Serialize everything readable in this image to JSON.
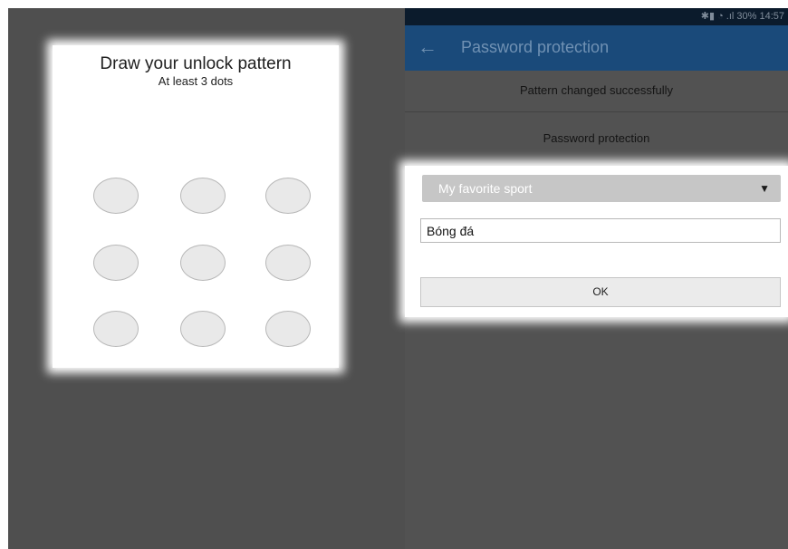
{
  "pattern_screen": {
    "title": "Draw your unlock pattern",
    "subtitle": "At least 3 dots",
    "dots": 9
  },
  "status_bar": {
    "text": "30% 14:57"
  },
  "app_bar": {
    "back_icon": "arrow-left-icon",
    "title": "Password protection"
  },
  "messages": {
    "pattern_changed": "Pattern changed successfully",
    "section_title": "Password protection"
  },
  "form": {
    "question_select": "My favorite sport",
    "answer_value": "Bóng đá",
    "ok_label": "OK"
  },
  "colors": {
    "app_bar": "#1a4a7a",
    "background": "#4f4f4f"
  }
}
